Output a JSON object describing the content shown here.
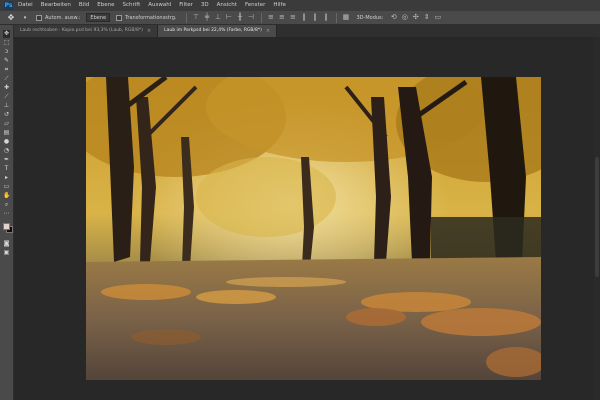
{
  "app": {
    "logo": "Ps",
    "menu": [
      "Datei",
      "Bearbeiten",
      "Bild",
      "Ebene",
      "Schrift",
      "Auswahl",
      "Filter",
      "3D",
      "Ansicht",
      "Fenster",
      "Hilfe"
    ]
  },
  "options": {
    "auto_select_label": "Autom. ausw.:",
    "auto_select_value": "Ebene",
    "transform_label": "Transformationsstrg."
  },
  "tabs": [
    {
      "label": "Laub rechtsoben · Kopie.psd bei 93,3% (Laub, RGB/8*)",
      "active": false
    },
    {
      "label": "Laub im Parkpsd bei 22,4% (Farbe, RGB/8*)",
      "active": true
    }
  ],
  "colors": {
    "foreground": "#e6d2cd",
    "background": "#111111",
    "ui_dark": "#282828",
    "ui_panel": "#4a4a4a"
  },
  "icons": {
    "move_tool": "move-icon",
    "canvas_image": "autumn-park-photo"
  }
}
